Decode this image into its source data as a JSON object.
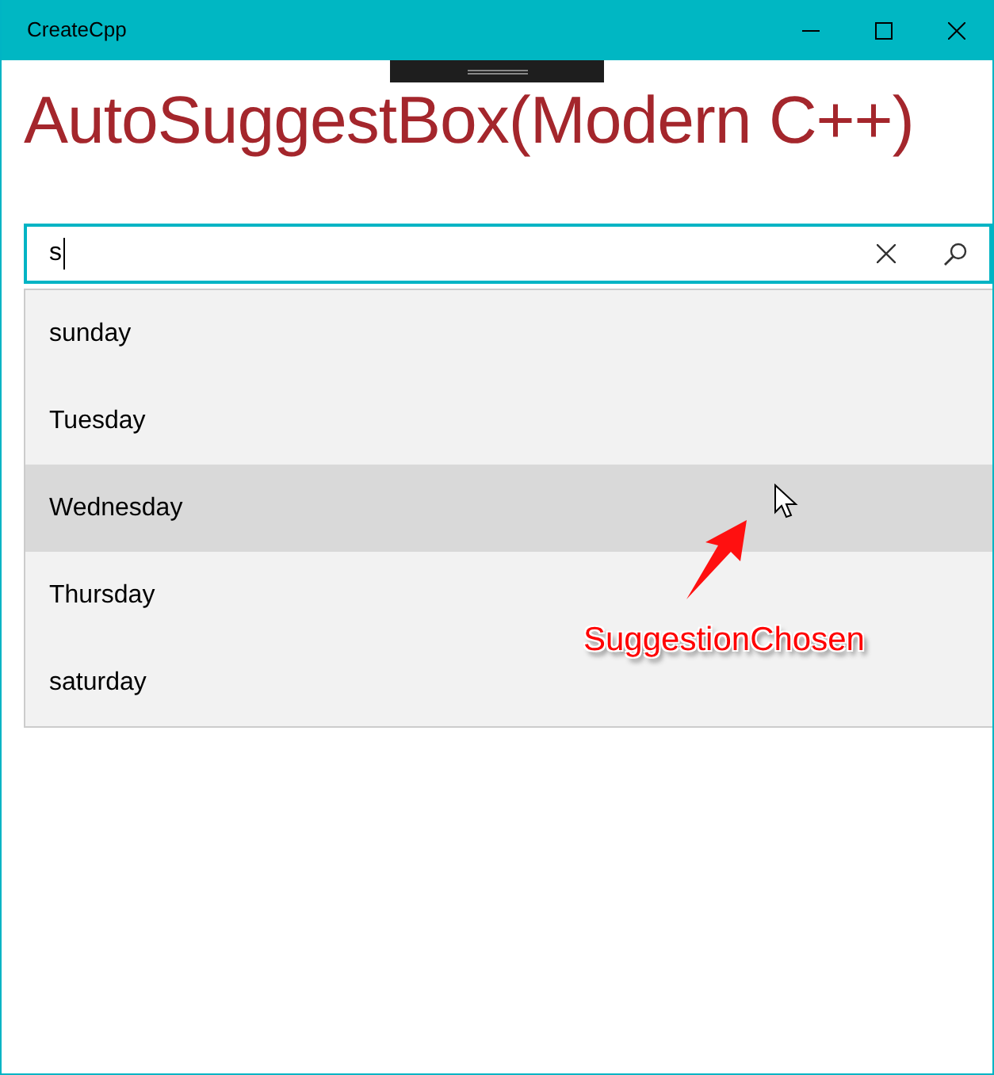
{
  "window": {
    "title": "CreateCpp"
  },
  "heading": "AutoSuggestBox(Modern C++)",
  "search": {
    "value": "s"
  },
  "suggestions": [
    {
      "label": "sunday",
      "selected": false
    },
    {
      "label": "Tuesday",
      "selected": false
    },
    {
      "label": "Wednesday",
      "selected": true
    },
    {
      "label": "Thursday",
      "selected": false
    },
    {
      "label": "saturday",
      "selected": false
    }
  ],
  "annotation": "SuggestionChosen"
}
